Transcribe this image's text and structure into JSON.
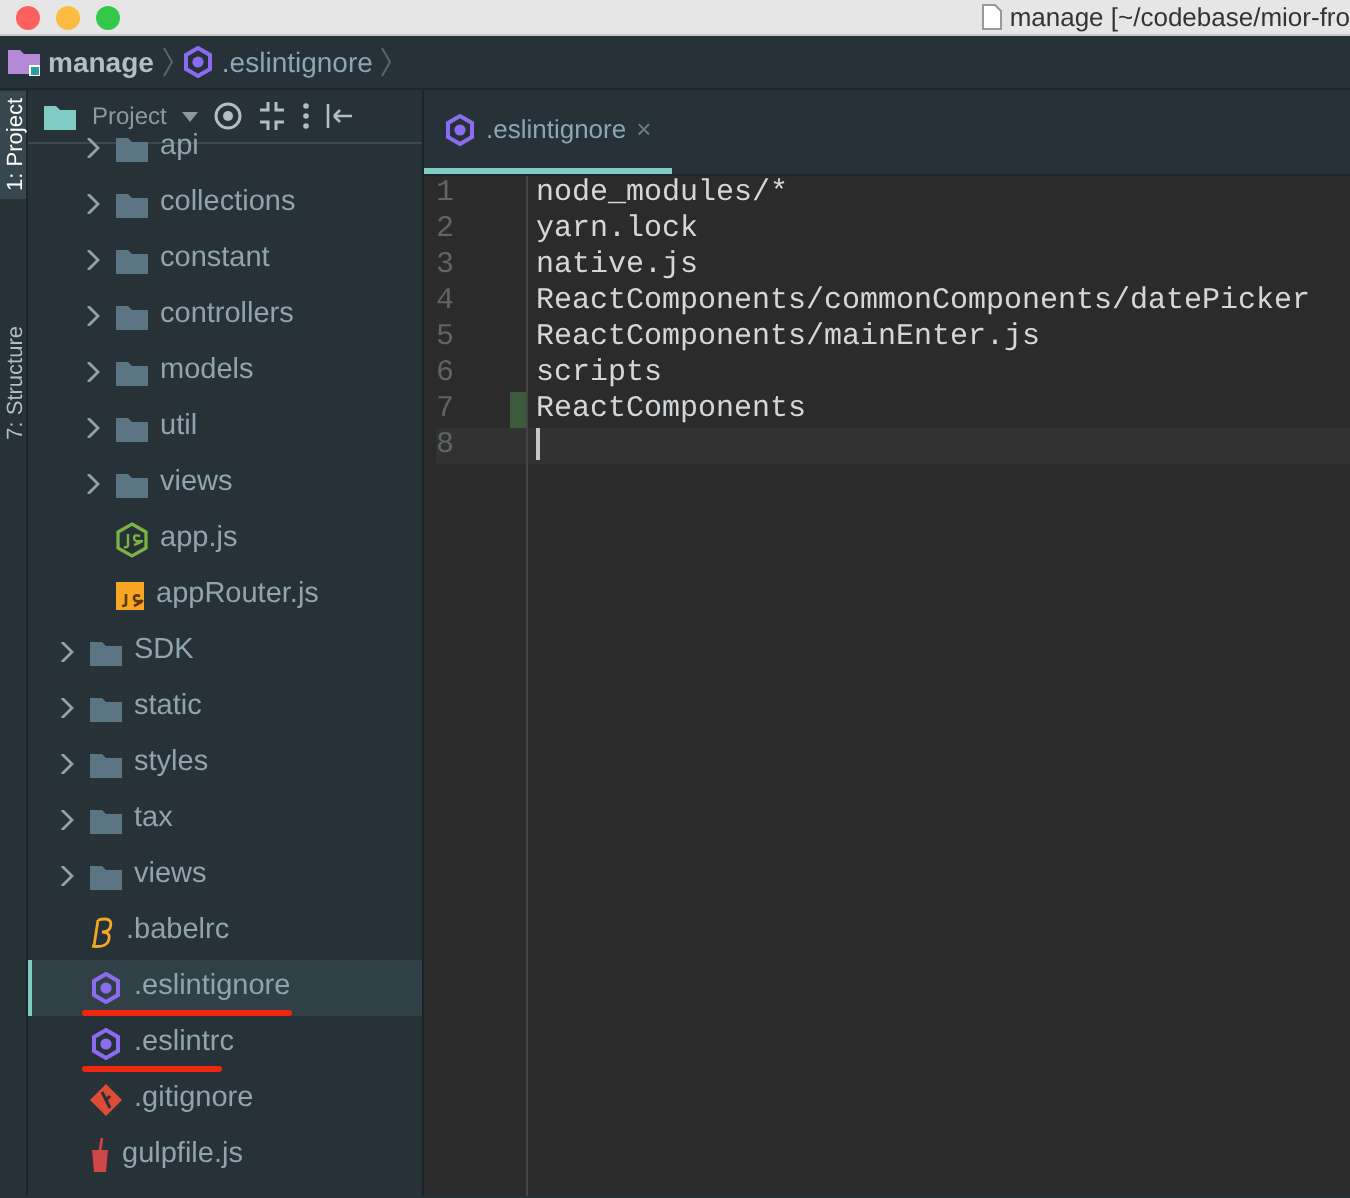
{
  "window": {
    "title": "manage [~/codebase/mior-fro"
  },
  "breadcrumbs": [
    {
      "label": "manage",
      "kind": "folder"
    },
    {
      "label": ".eslintignore",
      "kind": "eslint"
    }
  ],
  "tool_stripe": [
    {
      "label": "1: Project",
      "selected": true
    },
    {
      "label": "7: Structure",
      "selected": false
    }
  ],
  "project_panel": {
    "title": "Project",
    "scrolled_folder_contents": [
      {
        "label": "api",
        "kind": "folder",
        "expanded": false
      },
      {
        "label": "collections",
        "kind": "folder",
        "expanded": false
      },
      {
        "label": "constant",
        "kind": "folder",
        "expanded": false
      },
      {
        "label": "controllers",
        "kind": "folder",
        "expanded": false
      },
      {
        "label": "models",
        "kind": "folder",
        "expanded": false
      },
      {
        "label": "util",
        "kind": "folder",
        "expanded": false
      },
      {
        "label": "views",
        "kind": "folder",
        "expanded": false
      },
      {
        "label": "app.js",
        "kind": "node"
      },
      {
        "label": "appRouter.js",
        "kind": "js"
      }
    ],
    "items": [
      {
        "label": "SDK",
        "kind": "folder",
        "expanded": false
      },
      {
        "label": "static",
        "kind": "folder",
        "expanded": false
      },
      {
        "label": "styles",
        "kind": "folder",
        "expanded": false
      },
      {
        "label": "tax",
        "kind": "folder",
        "expanded": false
      },
      {
        "label": "views",
        "kind": "folder",
        "expanded": false
      },
      {
        "label": ".babelrc",
        "kind": "babel",
        "selected": false,
        "annotated": false
      },
      {
        "label": ".eslintignore",
        "kind": "eslint",
        "selected": true,
        "annotated": true
      },
      {
        "label": ".eslintrc",
        "kind": "eslint",
        "selected": false,
        "annotated": true
      },
      {
        "label": ".gitignore",
        "kind": "git",
        "selected": false,
        "annotated": false
      },
      {
        "label": "gulpfile.js",
        "kind": "gulp",
        "selected": false,
        "annotated": false
      }
    ]
  },
  "editor": {
    "tabs": [
      {
        "label": ".eslintignore",
        "selected": true,
        "close": "×"
      }
    ],
    "lines": [
      {
        "number": "1",
        "text": "node_modules/*",
        "modified": false,
        "current": false
      },
      {
        "number": "2",
        "text": "yarn.lock",
        "modified": false,
        "current": false
      },
      {
        "number": "3",
        "text": "native.js",
        "modified": false,
        "current": false
      },
      {
        "number": "4",
        "text": "ReactComponents/commonComponents/datePicker",
        "modified": false,
        "current": false
      },
      {
        "number": "5",
        "text": "ReactComponents/mainEnter.js",
        "modified": false,
        "current": false
      },
      {
        "number": "6",
        "text": "scripts",
        "modified": false,
        "current": false
      },
      {
        "number": "7",
        "text": "ReactComponents",
        "modified": true,
        "current": false
      },
      {
        "number": "8",
        "modified": false,
        "current": true
      }
    ]
  }
}
